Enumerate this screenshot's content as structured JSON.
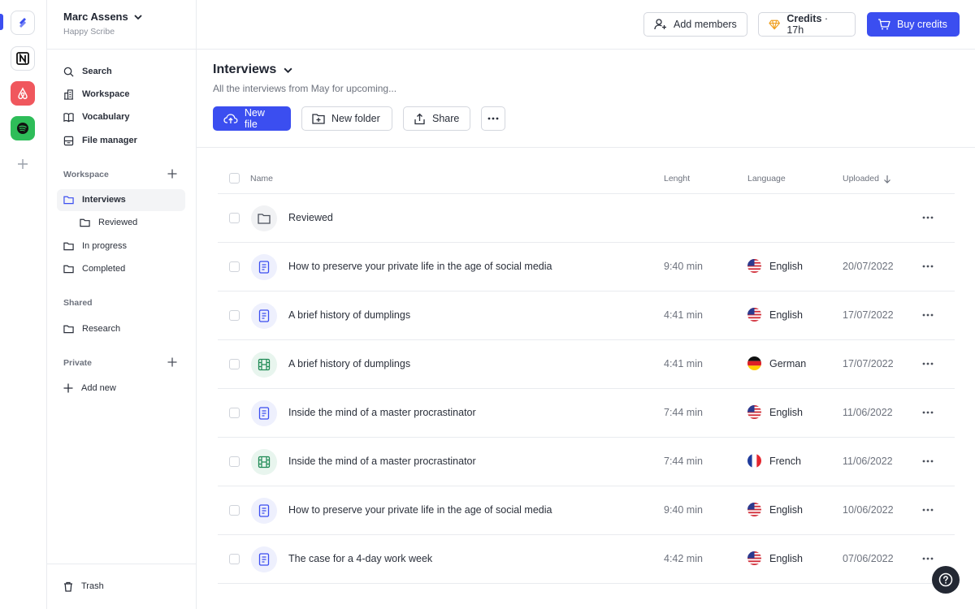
{
  "account": {
    "name": "Marc Assens",
    "org": "Happy Scribe"
  },
  "apps": [
    "happy-scribe",
    "notion",
    "airbnb",
    "spotify"
  ],
  "sidebar": {
    "nav": [
      {
        "label": "Search",
        "icon": "search-icon"
      },
      {
        "label": "Workspace",
        "icon": "building-icon"
      },
      {
        "label": "Vocabulary",
        "icon": "book-icon"
      },
      {
        "label": "File manager",
        "icon": "archive-icon"
      }
    ],
    "workspace_label": "Workspace",
    "workspace_items": [
      {
        "label": "Interviews",
        "active": true
      },
      {
        "label": "Reviewed",
        "nested": true
      },
      {
        "label": "In progress"
      },
      {
        "label": "Completed"
      }
    ],
    "shared_label": "Shared",
    "shared_items": [
      {
        "label": "Research"
      }
    ],
    "private_label": "Private",
    "add_new": "Add new",
    "trash": "Trash"
  },
  "topbar": {
    "add_members": "Add members",
    "credits_label": "Credits",
    "credits_value": "· 17h",
    "buy_credits": "Buy credits",
    "accent": "#3b4ef0"
  },
  "folder": {
    "title": "Interviews",
    "description": "All the interviews from May for upcoming...",
    "new_file": "New file",
    "new_folder": "New folder",
    "share": "Share"
  },
  "table": {
    "columns": {
      "name": "Name",
      "length": "Lenght",
      "language": "Language",
      "uploaded": "Uploaded"
    },
    "rows": [
      {
        "type": "folder",
        "name": "Reviewed",
        "length": "",
        "language": "",
        "flag": "",
        "uploaded": ""
      },
      {
        "type": "doc",
        "name": "How to preserve your private life in the age of social media",
        "length": "9:40 min",
        "language": "English",
        "flag": "us",
        "uploaded": "20/07/2022"
      },
      {
        "type": "doc",
        "name": "A brief history of dumplings",
        "length": "4:41 min",
        "language": "English",
        "flag": "us",
        "uploaded": "17/07/2022"
      },
      {
        "type": "video",
        "name": "A brief history of dumplings",
        "length": "4:41 min",
        "language": "German",
        "flag": "de",
        "uploaded": "17/07/2022"
      },
      {
        "type": "doc",
        "name": "Inside the mind of a master procrastinator",
        "length": "7:44 min",
        "language": "English",
        "flag": "us",
        "uploaded": "11/06/2022"
      },
      {
        "type": "video",
        "name": "Inside the mind of a master procrastinator",
        "length": "7:44 min",
        "language": "French",
        "flag": "fr",
        "uploaded": "11/06/2022"
      },
      {
        "type": "doc",
        "name": "How to preserve your private life in the age of social media",
        "length": "9:40 min",
        "language": "English",
        "flag": "us",
        "uploaded": "10/06/2022"
      },
      {
        "type": "doc",
        "name": "The case for a 4-day work week",
        "length": "4:42 min",
        "language": "English",
        "flag": "us",
        "uploaded": "07/06/2022"
      }
    ]
  }
}
